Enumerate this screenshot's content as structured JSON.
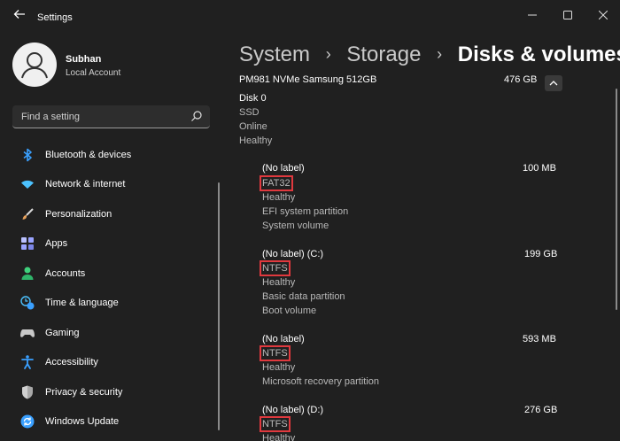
{
  "window": {
    "title": "Settings"
  },
  "user": {
    "name": "Subhan",
    "account_type": "Local Account"
  },
  "search": {
    "placeholder": "Find a setting"
  },
  "sidebar": {
    "items": [
      {
        "label": "Bluetooth & devices",
        "icon": "bluetooth-icon",
        "color": "#3aa0ff"
      },
      {
        "label": "Network & internet",
        "icon": "wifi-icon",
        "color": "#4cc2ff"
      },
      {
        "label": "Personalization",
        "icon": "brush-icon",
        "color": "#e8a25c"
      },
      {
        "label": "Apps",
        "icon": "apps-icon",
        "color": "#9aa4ff"
      },
      {
        "label": "Accounts",
        "icon": "person-icon",
        "color": "#3fd17c"
      },
      {
        "label": "Time & language",
        "icon": "clock-globe-icon",
        "color": "#4cc2ff"
      },
      {
        "label": "Gaming",
        "icon": "gamepad-icon",
        "color": "#c8c8c8"
      },
      {
        "label": "Accessibility",
        "icon": "accessibility-icon",
        "color": "#3aa0ff"
      },
      {
        "label": "Privacy & security",
        "icon": "shield-icon",
        "color": "#a8a8a8"
      },
      {
        "label": "Windows Update",
        "icon": "update-icon",
        "color": "#3aa0ff"
      }
    ]
  },
  "breadcrumb": {
    "item1": "System",
    "item2": "Storage",
    "current": "Disks & volumes"
  },
  "disk": {
    "name": "PM981 NVMe Samsung 512GB",
    "size": "476 GB",
    "label": "Disk 0",
    "type": "SSD",
    "status": "Online",
    "health": "Healthy"
  },
  "volumes": [
    {
      "name": "(No label)",
      "size": "100 MB",
      "fs": "FAT32",
      "health": "Healthy",
      "detail1": "EFI system partition",
      "detail2": "System volume"
    },
    {
      "name": "(No label) (C:)",
      "size": "199 GB",
      "fs": "NTFS",
      "health": "Healthy",
      "detail1": "Basic data partition",
      "detail2": "Boot volume"
    },
    {
      "name": "(No label)",
      "size": "593 MB",
      "fs": "NTFS",
      "health": "Healthy",
      "detail1": "Microsoft recovery partition"
    },
    {
      "name": "(No label) (D:)",
      "size": "276 GB",
      "fs": "NTFS",
      "health": "Healthy"
    }
  ],
  "colors": {
    "background": "#202020",
    "accent": "#3aa0ff",
    "highlight_box": "#e0393e"
  }
}
